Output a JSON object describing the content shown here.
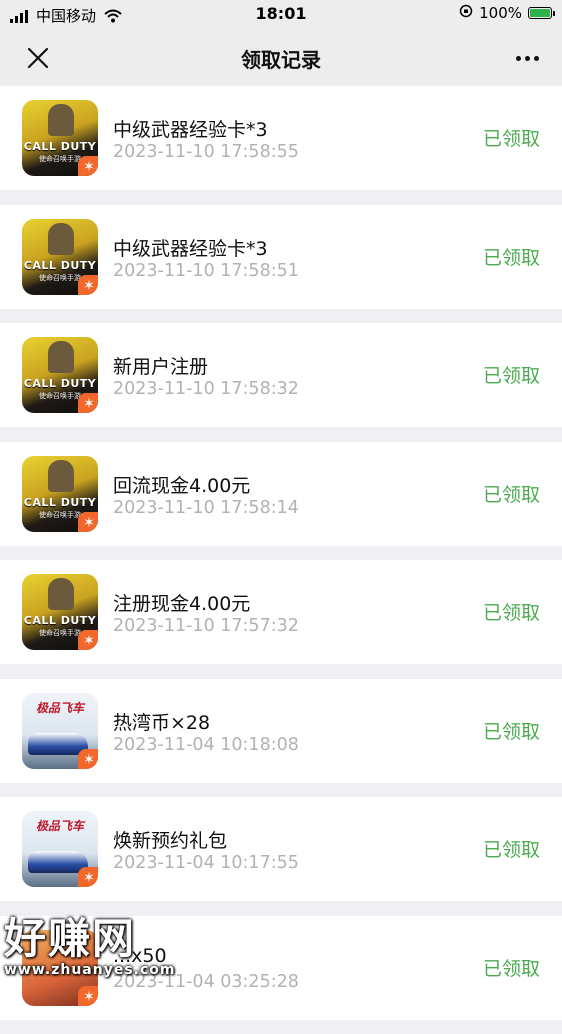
{
  "status_bar": {
    "carrier": "中国移动",
    "time": "18:01",
    "battery": "100%"
  },
  "nav": {
    "title": "领取记录"
  },
  "records": [
    {
      "title": "中级武器经验卡*3",
      "time": "2023-11-10 17:58:55",
      "status": "已领取",
      "game": "cod"
    },
    {
      "title": "中级武器经验卡*3",
      "time": "2023-11-10 17:58:51",
      "status": "已领取",
      "game": "cod"
    },
    {
      "title": "新用户注册",
      "time": "2023-11-10 17:58:32",
      "status": "已领取",
      "game": "cod"
    },
    {
      "title": "回流现金4.00元",
      "time": "2023-11-10 17:58:14",
      "status": "已领取",
      "game": "cod"
    },
    {
      "title": "注册现金4.00元",
      "time": "2023-11-10 17:57:32",
      "status": "已领取",
      "game": "cod"
    },
    {
      "title": "热湾币×28",
      "time": "2023-11-04 10:18:08",
      "status": "已领取",
      "game": "nfs"
    },
    {
      "title": "焕新预约礼包",
      "time": "2023-11-04 10:17:55",
      "status": "已领取",
      "game": "nfs"
    },
    {
      "title": "...x50",
      "time": "2023-11-04 03:25:28",
      "status": "已领取",
      "game": "other"
    }
  ],
  "game_icons": {
    "cod": {
      "label": "CALL DUTY",
      "sub": "使命召唤手游"
    },
    "nfs": {
      "label": "极品飞车"
    }
  },
  "watermark": {
    "text": "好赚网",
    "url": "www.zhuanyes.com"
  },
  "colors": {
    "accent_green": "#4cab50",
    "time_gray": "#b2b2b2",
    "background": "#efeff4"
  }
}
